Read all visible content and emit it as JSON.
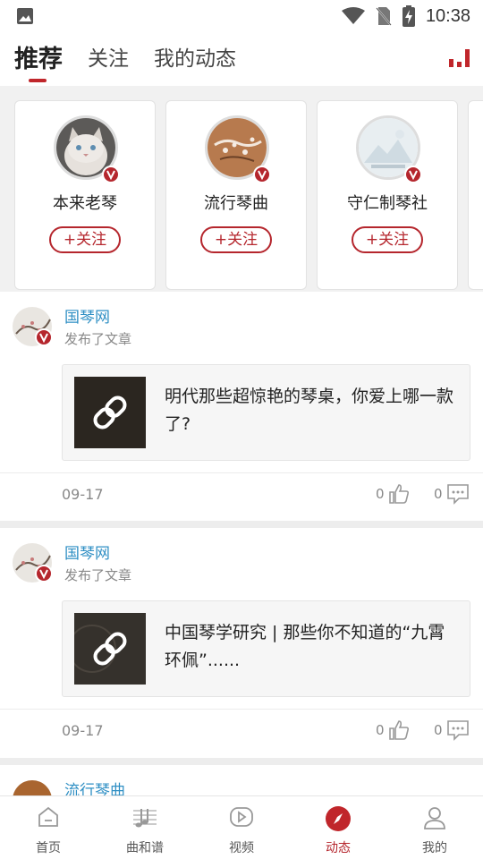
{
  "status_bar": {
    "time": "10:38"
  },
  "top_tabs": [
    {
      "label": "推荐",
      "active": true
    },
    {
      "label": "关注",
      "active": false
    },
    {
      "label": "我的动态",
      "active": false
    }
  ],
  "recommend_cards": [
    {
      "name": "本来老琴",
      "follow_label": "+关注"
    },
    {
      "name": "流行琴曲",
      "follow_label": "+关注"
    },
    {
      "name": "守仁制琴社",
      "follow_label": "+关注"
    }
  ],
  "posts": [
    {
      "author": "国琴网",
      "action": "发布了文章",
      "title": "明代那些超惊艳的琴桌，你爱上哪一款了?",
      "date": "09-17",
      "likes": "0",
      "comments": "0"
    },
    {
      "author": "国琴网",
      "action": "发布了文章",
      "title": "中国琴学研究 | 那些你不知道的“九霄环佩”......",
      "date": "09-17",
      "likes": "0",
      "comments": "0"
    },
    {
      "author": "流行琴曲"
    }
  ],
  "bottom_nav": [
    {
      "label": "首页",
      "icon": "home-icon"
    },
    {
      "label": "曲和谱",
      "icon": "music-score-icon"
    },
    {
      "label": "视频",
      "icon": "video-icon"
    },
    {
      "label": "动态",
      "icon": "compass-icon",
      "active": true
    },
    {
      "label": "我的",
      "icon": "profile-icon"
    }
  ],
  "colors": {
    "accent": "#c0262b",
    "author_link": "#2f8fc4",
    "page_bg": "#f1f1f1"
  }
}
